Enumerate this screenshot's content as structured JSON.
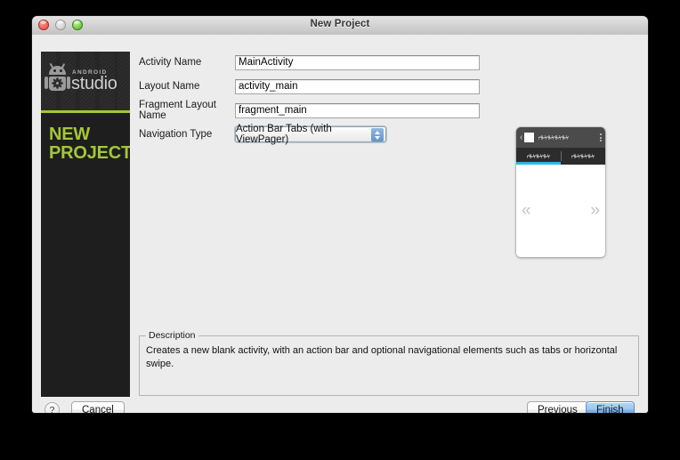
{
  "window": {
    "title": "New Project",
    "traffic_lights": [
      "close-button",
      "minimize-button",
      "zoom-button"
    ]
  },
  "sidebar": {
    "brand_small": "ANDROID",
    "brand_large": "studio",
    "headline_line1": "NEW",
    "headline_line2": "PROJECT",
    "accent_color": "#a4c639",
    "background_color": "#1e1e1e"
  },
  "form": {
    "fields": [
      {
        "label": "Activity Name",
        "value": "MainActivity",
        "type": "text"
      },
      {
        "label": "Layout Name",
        "value": "activity_main",
        "type": "text"
      },
      {
        "label": "Fragment Layout Name",
        "value": "fragment_main",
        "type": "text"
      }
    ],
    "navigation": {
      "label": "Navigation Type",
      "value": "Action Bar Tabs (with ViewPager)"
    }
  },
  "preview": {
    "back_icon": "‹",
    "overflow_icon": "overflow-menu-icon",
    "tab_count": 2,
    "selected_tab_index": 0,
    "tab_indicator_color": "#33b5e5",
    "swipe_left_icon": "«",
    "swipe_right_icon": "»",
    "action_bar_color": "#4b4b4b",
    "tab_bar_color": "#2c2c2c"
  },
  "description": {
    "legend": "Description",
    "text": "Creates a new blank activity, with an action bar and optional navigational elements such as tabs or horizontal swipe."
  },
  "footer": {
    "help_label": "?",
    "cancel_label": "Cancel",
    "previous_label": "Previous",
    "finish_label": "Finish"
  }
}
